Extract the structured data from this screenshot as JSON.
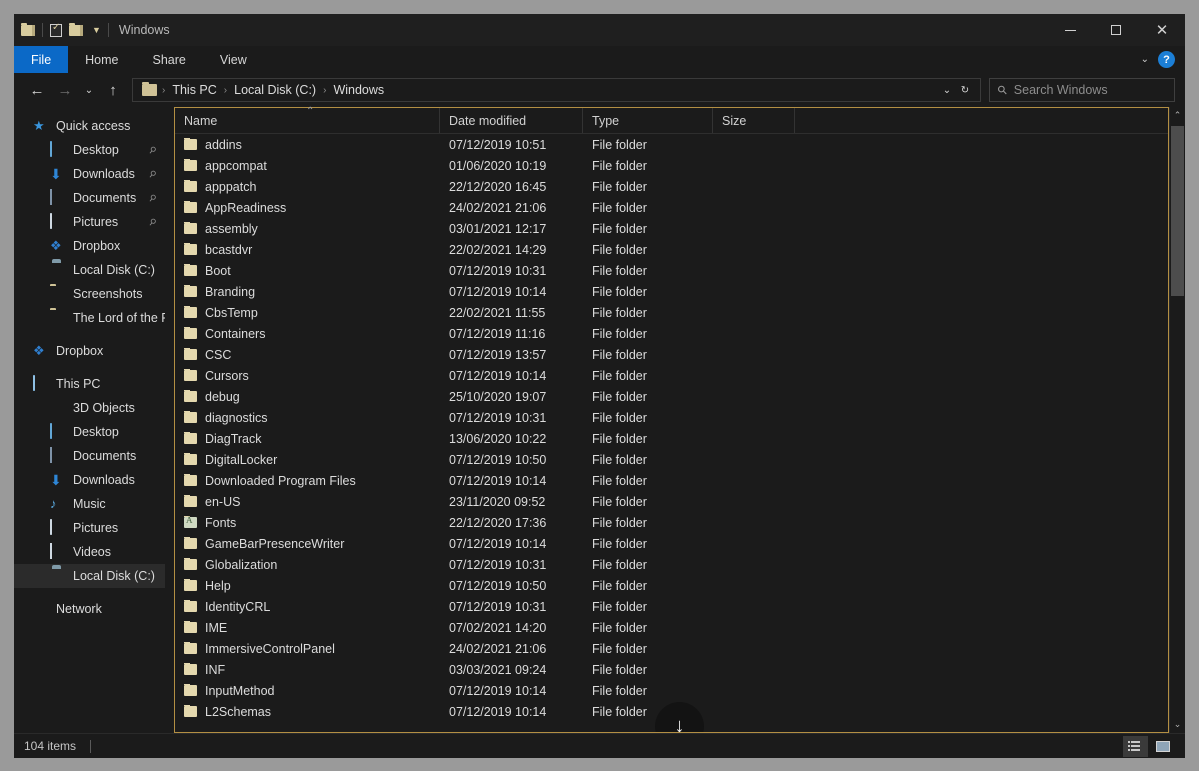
{
  "window": {
    "title": "Windows",
    "quick_access": [
      "folder-icon",
      "properties-icon",
      "new-folder-icon",
      "customize-chevron-icon"
    ],
    "controls": {
      "minimize": "minimize-icon",
      "maximize": "maximize-icon",
      "close": "close-icon"
    }
  },
  "ribbon": {
    "tabs": [
      {
        "label": "File",
        "active": true
      },
      {
        "label": "Home",
        "active": false
      },
      {
        "label": "Share",
        "active": false
      },
      {
        "label": "View",
        "active": false
      }
    ],
    "expand_icon": "chevron-down-icon",
    "help_label": "?"
  },
  "address": {
    "back": "back-arrow-icon",
    "forward": "forward-arrow-icon",
    "recent": "chevron-down-icon",
    "up": "up-arrow-icon",
    "breadcrumbs": [
      "This PC",
      "Local Disk (C:)",
      "Windows"
    ],
    "dropdown_icon": "chevron-down-icon",
    "refresh_icon": "refresh-icon"
  },
  "search": {
    "placeholder": "Search Windows",
    "icon": "search-icon"
  },
  "sidebar": {
    "groups": [
      {
        "header": {
          "label": "Quick access",
          "icon": "star-icon",
          "indent": 0
        },
        "items": [
          {
            "label": "Desktop",
            "icon": "monitor-icon",
            "pinned": true,
            "indent": 1
          },
          {
            "label": "Downloads",
            "icon": "download-icon",
            "pinned": true,
            "indent": 1
          },
          {
            "label": "Documents",
            "icon": "document-icon",
            "pinned": true,
            "indent": 1
          },
          {
            "label": "Pictures",
            "icon": "picture-icon",
            "pinned": true,
            "indent": 1
          },
          {
            "label": "Dropbox",
            "icon": "dropbox-icon",
            "pinned": false,
            "indent": 1
          },
          {
            "label": "Local Disk (C:)",
            "icon": "disk-icon",
            "pinned": false,
            "indent": 1
          },
          {
            "label": "Screenshots",
            "icon": "folder-icon",
            "pinned": false,
            "indent": 1
          },
          {
            "label": "The Lord of the Ring",
            "icon": "folder-icon",
            "pinned": false,
            "indent": 1
          }
        ]
      },
      {
        "header": {
          "label": "Dropbox",
          "icon": "dropbox-icon",
          "indent": 0
        },
        "items": []
      },
      {
        "header": {
          "label": "This PC",
          "icon": "pc-icon",
          "indent": 0
        },
        "items": [
          {
            "label": "3D Objects",
            "icon": "cube-icon",
            "pinned": false,
            "indent": 1
          },
          {
            "label": "Desktop",
            "icon": "monitor-icon",
            "pinned": false,
            "indent": 1
          },
          {
            "label": "Documents",
            "icon": "document-icon",
            "pinned": false,
            "indent": 1
          },
          {
            "label": "Downloads",
            "icon": "download-icon",
            "pinned": false,
            "indent": 1
          },
          {
            "label": "Music",
            "icon": "music-icon",
            "pinned": false,
            "indent": 1
          },
          {
            "label": "Pictures",
            "icon": "picture-icon",
            "pinned": false,
            "indent": 1
          },
          {
            "label": "Videos",
            "icon": "video-icon",
            "pinned": false,
            "indent": 1
          },
          {
            "label": "Local Disk (C:)",
            "icon": "disk-icon",
            "pinned": false,
            "indent": 1,
            "selected": true
          }
        ]
      },
      {
        "header": {
          "label": "Network",
          "icon": "network-icon",
          "indent": 0
        },
        "items": []
      }
    ]
  },
  "file_list": {
    "columns": [
      "Name",
      "Date modified",
      "Type",
      "Size"
    ],
    "sort_indicator": "ascending",
    "rows": [
      {
        "name": "addins",
        "date": "07/12/2019 10:51",
        "type": "File folder",
        "size": "",
        "icon": "folder-icon"
      },
      {
        "name": "appcompat",
        "date": "01/06/2020 10:19",
        "type": "File folder",
        "size": "",
        "icon": "folder-icon"
      },
      {
        "name": "apppatch",
        "date": "22/12/2020 16:45",
        "type": "File folder",
        "size": "",
        "icon": "folder-icon"
      },
      {
        "name": "AppReadiness",
        "date": "24/02/2021 21:06",
        "type": "File folder",
        "size": "",
        "icon": "folder-icon"
      },
      {
        "name": "assembly",
        "date": "03/01/2021 12:17",
        "type": "File folder",
        "size": "",
        "icon": "folder-icon"
      },
      {
        "name": "bcastdvr",
        "date": "22/02/2021 14:29",
        "type": "File folder",
        "size": "",
        "icon": "folder-icon"
      },
      {
        "name": "Boot",
        "date": "07/12/2019 10:31",
        "type": "File folder",
        "size": "",
        "icon": "folder-icon"
      },
      {
        "name": "Branding",
        "date": "07/12/2019 10:14",
        "type": "File folder",
        "size": "",
        "icon": "folder-icon"
      },
      {
        "name": "CbsTemp",
        "date": "22/02/2021 11:55",
        "type": "File folder",
        "size": "",
        "icon": "folder-icon"
      },
      {
        "name": "Containers",
        "date": "07/12/2019 11:16",
        "type": "File folder",
        "size": "",
        "icon": "folder-icon"
      },
      {
        "name": "CSC",
        "date": "07/12/2019 13:57",
        "type": "File folder",
        "size": "",
        "icon": "folder-icon"
      },
      {
        "name": "Cursors",
        "date": "07/12/2019 10:14",
        "type": "File folder",
        "size": "",
        "icon": "folder-icon"
      },
      {
        "name": "debug",
        "date": "25/10/2020 19:07",
        "type": "File folder",
        "size": "",
        "icon": "folder-icon"
      },
      {
        "name": "diagnostics",
        "date": "07/12/2019 10:31",
        "type": "File folder",
        "size": "",
        "icon": "folder-icon"
      },
      {
        "name": "DiagTrack",
        "date": "13/06/2020 10:22",
        "type": "File folder",
        "size": "",
        "icon": "folder-icon"
      },
      {
        "name": "DigitalLocker",
        "date": "07/12/2019 10:50",
        "type": "File folder",
        "size": "",
        "icon": "folder-icon"
      },
      {
        "name": "Downloaded Program Files",
        "date": "07/12/2019 10:14",
        "type": "File folder",
        "size": "",
        "icon": "folder-icon"
      },
      {
        "name": "en-US",
        "date": "23/11/2020 09:52",
        "type": "File folder",
        "size": "",
        "icon": "folder-icon"
      },
      {
        "name": "Fonts",
        "date": "22/12/2020 17:36",
        "type": "File folder",
        "size": "",
        "icon": "fonts-folder-icon"
      },
      {
        "name": "GameBarPresenceWriter",
        "date": "07/12/2019 10:14",
        "type": "File folder",
        "size": "",
        "icon": "folder-icon"
      },
      {
        "name": "Globalization",
        "date": "07/12/2019 10:31",
        "type": "File folder",
        "size": "",
        "icon": "folder-icon"
      },
      {
        "name": "Help",
        "date": "07/12/2019 10:50",
        "type": "File folder",
        "size": "",
        "icon": "folder-icon"
      },
      {
        "name": "IdentityCRL",
        "date": "07/12/2019 10:31",
        "type": "File folder",
        "size": "",
        "icon": "folder-icon"
      },
      {
        "name": "IME",
        "date": "07/02/2021 14:20",
        "type": "File folder",
        "size": "",
        "icon": "folder-icon"
      },
      {
        "name": "ImmersiveControlPanel",
        "date": "24/02/2021 21:06",
        "type": "File folder",
        "size": "",
        "icon": "folder-icon"
      },
      {
        "name": "INF",
        "date": "03/03/2021 09:24",
        "type": "File folder",
        "size": "",
        "icon": "folder-icon"
      },
      {
        "name": "InputMethod",
        "date": "07/12/2019 10:14",
        "type": "File folder",
        "size": "",
        "icon": "folder-icon"
      },
      {
        "name": "L2Schemas",
        "date": "07/12/2019 10:14",
        "type": "File folder",
        "size": "",
        "icon": "folder-icon"
      }
    ],
    "scroll_hint_icon": "arrow-down-icon"
  },
  "status": {
    "item_count": "104 items",
    "view_details_icon": "details-view-icon",
    "view_large_icons_icon": "large-icons-view-icon"
  },
  "colors": {
    "accent_blue": "#0b69c7",
    "pane_border": "#b38f43",
    "folder": "#e4d8ae",
    "window_bg": "#1b1b1b",
    "desktop": "#9a9a9a"
  }
}
